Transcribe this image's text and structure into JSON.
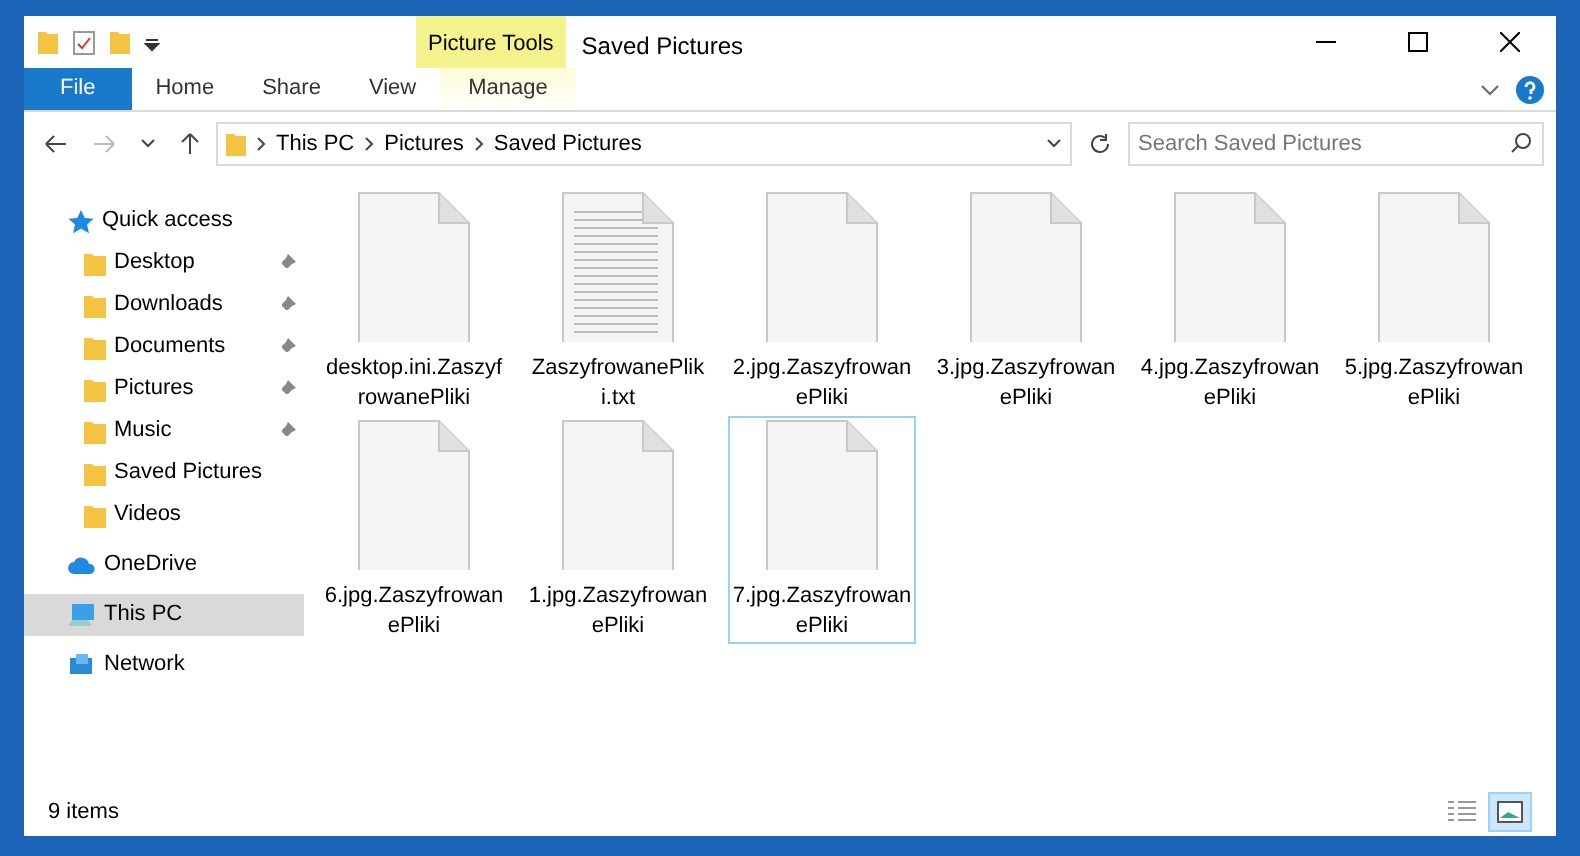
{
  "window": {
    "title": "Saved Pictures",
    "contextual_tab": "Picture Tools"
  },
  "ribbon_tabs": [
    {
      "label": "File",
      "kind": "file"
    },
    {
      "label": "Home",
      "kind": "normal"
    },
    {
      "label": "Share",
      "kind": "normal"
    },
    {
      "label": "View",
      "kind": "normal"
    },
    {
      "label": "Manage",
      "kind": "contextual"
    }
  ],
  "address_bar": {
    "breadcrumb": [
      "This PC",
      "Pictures",
      "Saved Pictures"
    ]
  },
  "search": {
    "placeholder": "Search Saved Pictures"
  },
  "navigation": [
    {
      "label": "Quick access",
      "kind": "star",
      "selected": false,
      "children": [
        {
          "label": "Desktop",
          "pinned": true,
          "selected": false
        },
        {
          "label": "Downloads",
          "pinned": true,
          "selected": false
        },
        {
          "label": "Documents",
          "pinned": true,
          "selected": false
        },
        {
          "label": "Pictures",
          "pinned": true,
          "selected": false
        },
        {
          "label": "Music",
          "pinned": true,
          "selected": false
        },
        {
          "label": "Saved Pictures",
          "pinned": false,
          "selected": false
        },
        {
          "label": "Videos",
          "pinned": false,
          "selected": false
        }
      ]
    },
    {
      "label": "OneDrive",
      "kind": "cloud",
      "selected": false
    },
    {
      "label": "This PC",
      "kind": "computer",
      "selected": true
    },
    {
      "label": "Network",
      "kind": "network",
      "selected": false
    }
  ],
  "files": [
    {
      "name": "desktop.ini.ZaszyfrowanePliki",
      "kind": "blank",
      "selected": false
    },
    {
      "name": "ZaszyfrowanePliki.txt",
      "kind": "text",
      "selected": false
    },
    {
      "name": "2.jpg.ZaszyfrowanePliki",
      "kind": "blank",
      "selected": false
    },
    {
      "name": "3.jpg.ZaszyfrowanePliki",
      "kind": "blank",
      "selected": false
    },
    {
      "name": "4.jpg.ZaszyfrowanePliki",
      "kind": "blank",
      "selected": false
    },
    {
      "name": "5.jpg.ZaszyfrowanePliki",
      "kind": "blank",
      "selected": false
    },
    {
      "name": "6.jpg.ZaszyfrowanePliki",
      "kind": "blank",
      "selected": false
    },
    {
      "name": "1.jpg.ZaszyfrowanePliki",
      "kind": "blank",
      "selected": false
    },
    {
      "name": "7.jpg.ZaszyfrowanePliki",
      "kind": "blank",
      "selected": true
    }
  ],
  "status_bar": {
    "item_count": "9 items",
    "views": [
      {
        "kind": "details",
        "selected": false
      },
      {
        "kind": "large-icons",
        "selected": true
      }
    ]
  }
}
